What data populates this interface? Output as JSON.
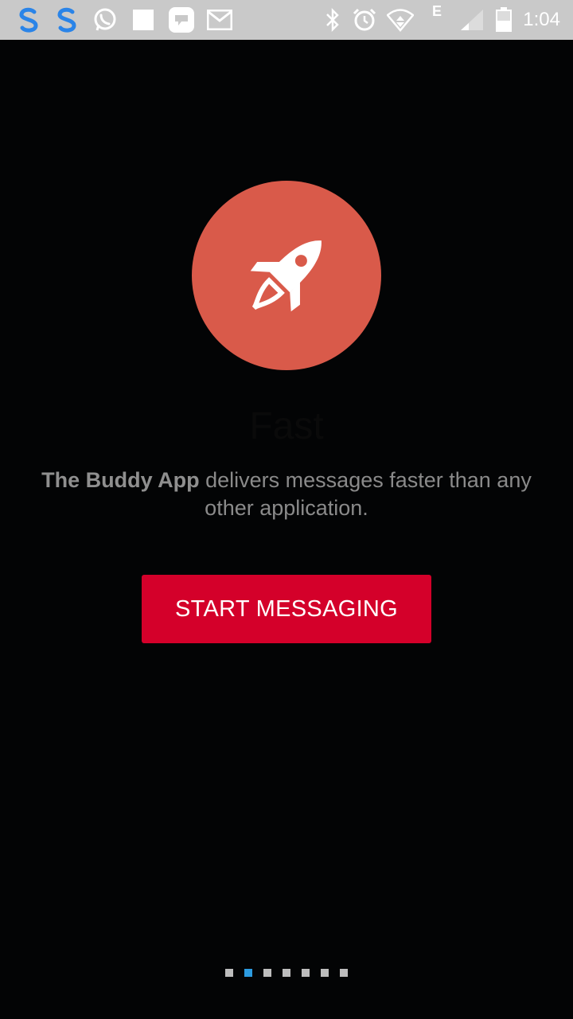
{
  "status_bar": {
    "time": "1:04",
    "network_type": "E",
    "icons": [
      "skype-icon",
      "skype-icon",
      "whatsapp-icon",
      "square-notification-icon",
      "messenger-icon",
      "gmail-icon",
      "bluetooth-icon",
      "alarm-icon",
      "wifi-icon",
      "signal-icon",
      "battery-icon"
    ]
  },
  "onboarding": {
    "icon": "rocket-icon",
    "accent_color": "#d95a4a",
    "title": "Fast",
    "description_brand": "The Buddy App",
    "description_rest": " delivers messages faster than any other application.",
    "cta_label": "START MESSAGING",
    "cta_color": "#d4002a"
  },
  "pager": {
    "page_count": 7,
    "active_index": 1,
    "active_color": "#2c9be0"
  }
}
